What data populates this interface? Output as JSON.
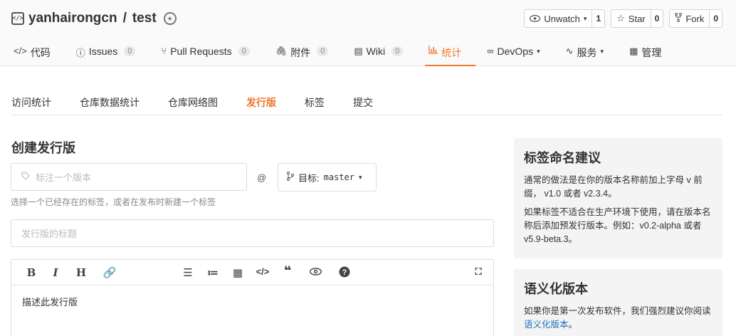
{
  "repo": {
    "owner": "yanhairongcn",
    "separator": "/",
    "name": "test"
  },
  "actions": [
    {
      "label": "Unwatch",
      "caret": "▾",
      "count": "1"
    },
    {
      "label": "Star",
      "count": "0"
    },
    {
      "label": "Fork",
      "count": "0"
    }
  ],
  "tabs": [
    {
      "icon": "code-icon",
      "label": "代码"
    },
    {
      "icon": "issues-icon",
      "label": "Issues",
      "count": "0"
    },
    {
      "icon": "pull-request-icon",
      "label": "Pull Requests",
      "count": "0"
    },
    {
      "icon": "attachment-icon",
      "label": "附件",
      "count": "0"
    },
    {
      "icon": "wiki-icon",
      "label": "Wiki",
      "count": "0"
    },
    {
      "icon": "stats-icon",
      "label": "统计",
      "active": true
    },
    {
      "icon": "devops-icon",
      "label": "DevOps",
      "caret": "▾"
    },
    {
      "icon": "service-icon",
      "label": "服务",
      "caret": "▾"
    },
    {
      "icon": "manage-icon",
      "label": "管理"
    }
  ],
  "subtabs": [
    {
      "label": "访问统计"
    },
    {
      "label": "仓库数据统计"
    },
    {
      "label": "仓库网络图"
    },
    {
      "label": "发行版",
      "active": true
    },
    {
      "label": "标签"
    },
    {
      "label": "提交"
    }
  ],
  "form": {
    "title": "创建发行版",
    "tag_placeholder": "标注一个版本",
    "at": "@",
    "target_label": "目标:",
    "target_value": "master",
    "tag_hint": "选择一个已经存在的标签，或者在发布时新建一个标签",
    "release_title_placeholder": "发行版的标题",
    "description": "描述此发行版"
  },
  "sidebar": {
    "card1": {
      "title": "标签命名建议",
      "p1": "通常的做法是在你的版本名称前加上字母 v 前缀， v1.0 或者 v2.3.4。",
      "p2": "如果标签不适合在生产环境下使用，请在版本名称后添加预发行版本。例如：v0.2-alpha 或者 v5.9-beta.3。"
    },
    "card2": {
      "title": "语义化版本",
      "text": "如果你是第一次发布软件，我们强烈建议你阅读 ",
      "link": "语义化版本",
      "end": "。"
    }
  }
}
